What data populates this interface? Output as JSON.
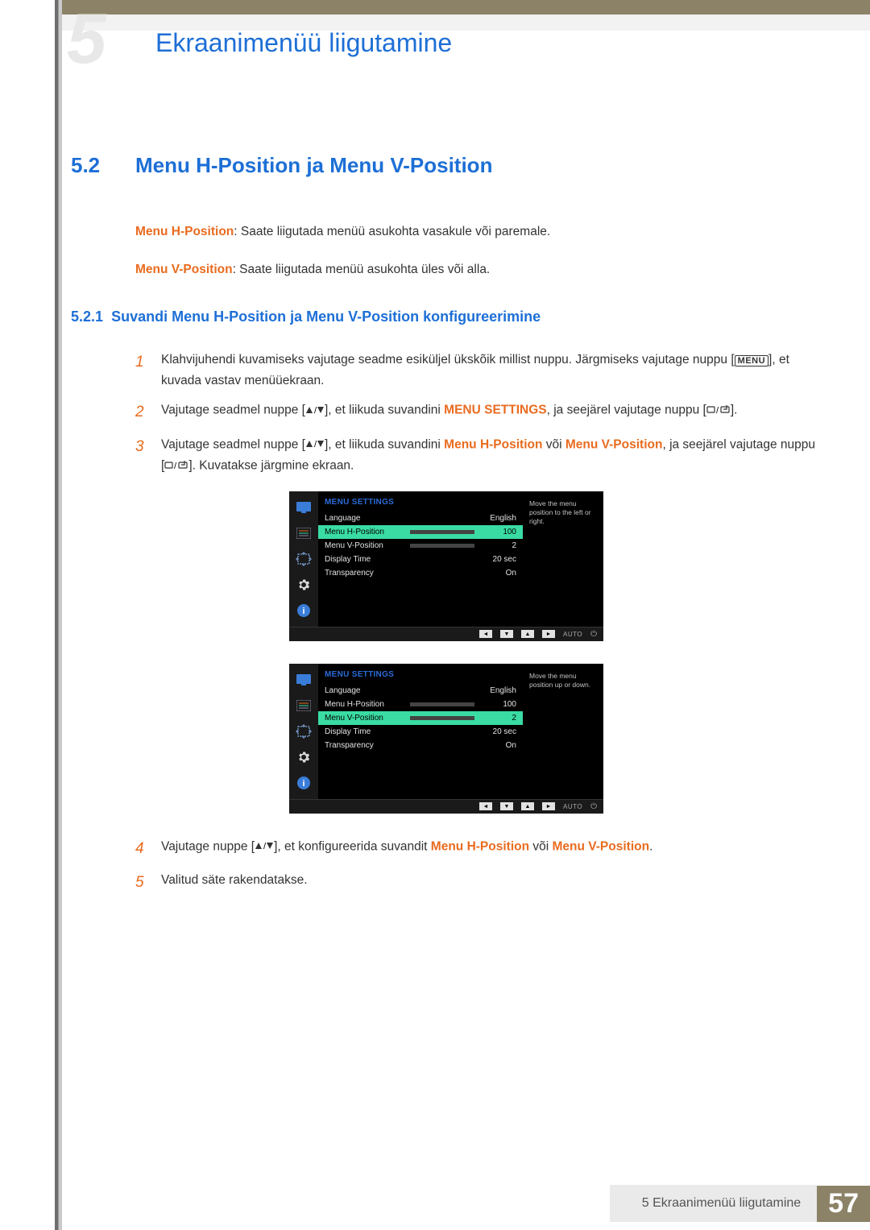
{
  "chapter_number": "5",
  "chapter_title": "Ekraanimenüü liigutamine",
  "section": {
    "num": "5.2",
    "title": "Menu H-Position ja Menu V-Position"
  },
  "intro": {
    "h": {
      "label": "Menu H-Position",
      "text": ": Saate liigutada menüü asukohta vasakule või paremale."
    },
    "v": {
      "label": "Menu V-Position",
      "text": ": Saate liigutada menüü asukohta üles või alla."
    }
  },
  "subsection": {
    "num": "5.2.1",
    "title": "Suvandi Menu H-Position ja Menu V-Position konfigureerimine"
  },
  "steps": {
    "s1": {
      "n": "1",
      "a": "Klahvijuhendi kuvamiseks vajutage seadme esiküljel ükskõik millist nuppu. Järgmiseks vajutage nuppu [",
      "menu": "MENU",
      "b": "], et kuvada vastav menüüekraan."
    },
    "s2": {
      "n": "2",
      "a": "Vajutage seadmel nuppe [",
      "b": "], et liikuda suvandini ",
      "hl": "MENU SETTINGS",
      "c": ", ja seejärel vajutage nuppu [",
      "d": "]."
    },
    "s3": {
      "n": "3",
      "a": "Vajutage seadmel nuppe [",
      "b": "], et liikuda suvandini ",
      "hl1": "Menu H-Position",
      "mid": " või ",
      "hl2": "Menu V-Position",
      "c": ", ja seejärel vajutage nuppu [",
      "d": "]. Kuvatakse järgmine ekraan."
    },
    "s4": {
      "n": "4",
      "a": "Vajutage nuppe [",
      "b": "], et konfigureerida suvandit ",
      "hl1": "Menu H-Position",
      "mid": " või ",
      "hl2": "Menu V-Position",
      "c": "."
    },
    "s5": {
      "n": "5",
      "a": "Valitud säte rakendatakse."
    }
  },
  "osd1": {
    "title": "MENU SETTINGS",
    "help": "Move the menu position to the left or right.",
    "rows": {
      "language": {
        "lbl": "Language",
        "val": "English"
      },
      "hpos": {
        "lbl": "Menu H-Position",
        "val": "100",
        "pct": 100
      },
      "vpos": {
        "lbl": "Menu V-Position",
        "val": "2",
        "pct": 2
      },
      "time": {
        "lbl": "Display Time",
        "val": "20 sec"
      },
      "trans": {
        "lbl": "Transparency",
        "val": "On"
      }
    },
    "footer_auto": "AUTO"
  },
  "osd2": {
    "title": "MENU SETTINGS",
    "help": "Move the menu position up or down.",
    "rows": {
      "language": {
        "lbl": "Language",
        "val": "English"
      },
      "hpos": {
        "lbl": "Menu H-Position",
        "val": "100",
        "pct": 100
      },
      "vpos": {
        "lbl": "Menu V-Position",
        "val": "2",
        "pct": 2
      },
      "time": {
        "lbl": "Display Time",
        "val": "20 sec"
      },
      "trans": {
        "lbl": "Transparency",
        "val": "On"
      }
    },
    "footer_auto": "AUTO"
  },
  "footer": {
    "text": "5  Ekraanimenüü liigutamine",
    "page": "57"
  }
}
